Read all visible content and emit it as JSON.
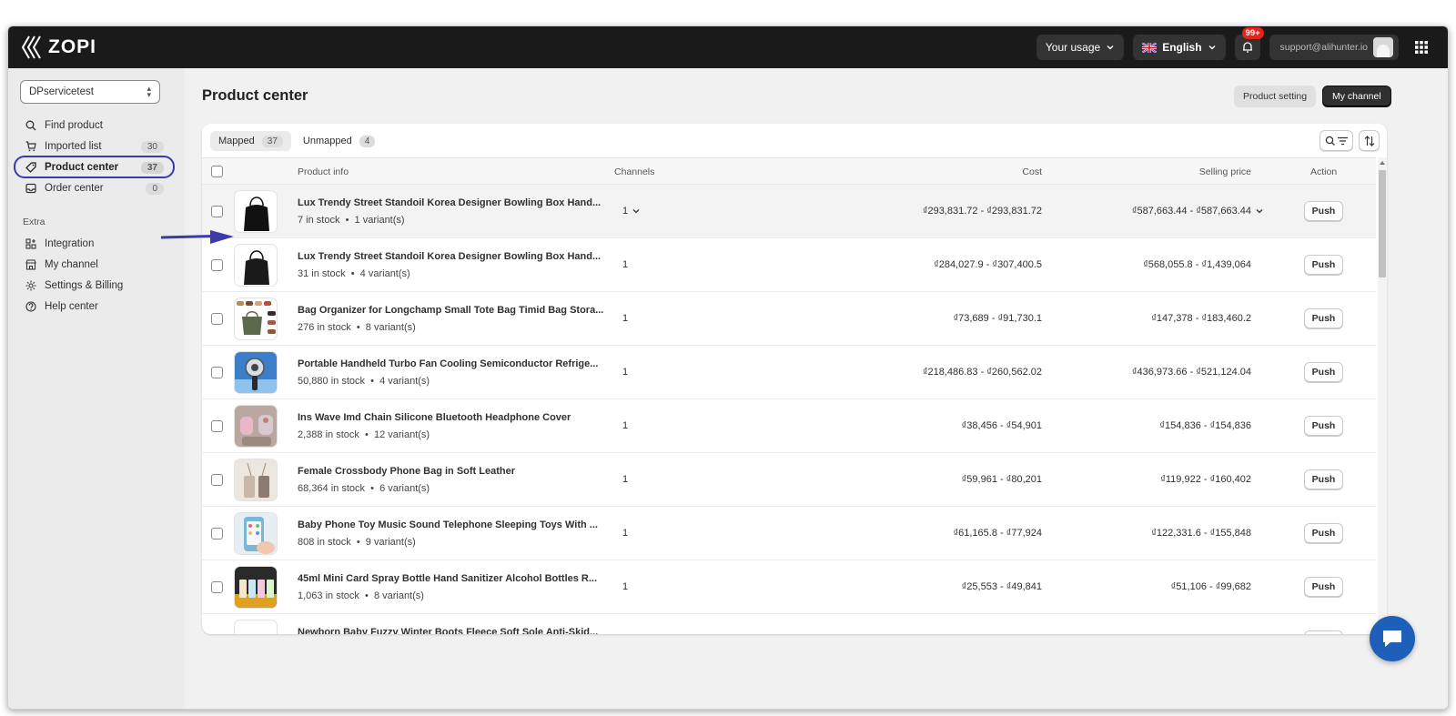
{
  "app": {
    "logo_text": "ZOPI"
  },
  "topbar": {
    "usage_label": "Your usage",
    "language_label": "English",
    "notifications_count": "99+",
    "user_email": "support@alihunter.io"
  },
  "sidebar": {
    "store_name": "DPservicetest",
    "items": [
      {
        "label": "Find product",
        "icon": "search-icon",
        "count": ""
      },
      {
        "label": "Imported list",
        "icon": "cart-icon",
        "count": "30"
      },
      {
        "label": "Product center",
        "icon": "tag-icon",
        "count": "37"
      },
      {
        "label": "Order center",
        "icon": "inbox-icon",
        "count": "0"
      }
    ],
    "extra_label": "Extra",
    "extra_items": [
      {
        "label": "Integration",
        "icon": "apps-icon"
      },
      {
        "label": "My channel",
        "icon": "store-icon"
      },
      {
        "label": "Settings & Billing",
        "icon": "gear-icon"
      },
      {
        "label": "Help center",
        "icon": "help-icon"
      }
    ]
  },
  "page": {
    "title": "Product center",
    "product_setting_label": "Product setting",
    "my_channel_label": "My channel"
  },
  "tabs": [
    {
      "label": "Mapped",
      "count": "37"
    },
    {
      "label": "Unmapped",
      "count": "4"
    }
  ],
  "table": {
    "columns": {
      "product_info": "Product info",
      "channels": "Channels",
      "cost": "Cost",
      "selling_price": "Selling price",
      "action": "Action"
    },
    "push_label": "Push",
    "rows": [
      {
        "name": "Lux Trendy Street Standoil Korea Designer Bowling Box Hand...",
        "stock": "7 in stock",
        "variants": "1 variant(s)",
        "channels": "1",
        "cost": "₫293,831.72 - ₫293,831.72",
        "price": "₫587,663.44 - ₫587,663.44"
      },
      {
        "name": "Lux Trendy Street Standoil Korea Designer Bowling Box Hand...",
        "stock": "31 in stock",
        "variants": "4 variant(s)",
        "channels": "1",
        "cost": "₫284,027.9 - ₫307,400.5",
        "price": "₫568,055.8 - ₫1,439,064"
      },
      {
        "name": "Bag Organizer for Longchamp Small Tote Bag Timid Bag Stora...",
        "stock": "276 in stock",
        "variants": "8 variant(s)",
        "channels": "1",
        "cost": "₫73,689 - ₫91,730.1",
        "price": "₫147,378 - ₫183,460.2"
      },
      {
        "name": "Portable Handheld Turbo Fan Cooling Semiconductor Refrige...",
        "stock": "50,880 in stock",
        "variants": "4 variant(s)",
        "channels": "1",
        "cost": "₫218,486.83 - ₫260,562.02",
        "price": "₫436,973.66 - ₫521,124.04"
      },
      {
        "name": "Ins Wave Imd Chain Silicone Bluetooth Headphone Cover",
        "stock": "2,388 in stock",
        "variants": "12 variant(s)",
        "channels": "1",
        "cost": "₫38,456 - ₫54,901",
        "price": "₫154,836 - ₫154,836"
      },
      {
        "name": "Female Crossbody Phone Bag in Soft Leather",
        "stock": "68,364 in stock",
        "variants": "6 variant(s)",
        "channels": "1",
        "cost": "₫59,961 - ₫80,201",
        "price": "₫119,922 - ₫160,402"
      },
      {
        "name": "Baby Phone Toy Music Sound Telephone Sleeping Toys With ...",
        "stock": "808 in stock",
        "variants": "9 variant(s)",
        "channels": "1",
        "cost": "₫61,165.8 - ₫77,924",
        "price": "₫122,331.6 - ₫155,848"
      },
      {
        "name": "45ml Mini Card Spray Bottle Hand Sanitizer Alcohol Bottles R...",
        "stock": "1,063 in stock",
        "variants": "8 variant(s)",
        "channels": "1",
        "cost": "₫25,553 - ₫49,841",
        "price": "₫51,106 - ₫99,682"
      },
      {
        "name": "Newborn Baby Fuzzy Winter Boots Fleece Soft Sole Anti-Skid...",
        "stock": "",
        "variants": "",
        "channels": "",
        "cost": "",
        "price": ""
      }
    ]
  },
  "colors": {
    "topbar": "#1a1a1a",
    "highlight": "#3a3aa8",
    "arrow": "#3a3aa8",
    "chat": "#1d5fb9"
  }
}
